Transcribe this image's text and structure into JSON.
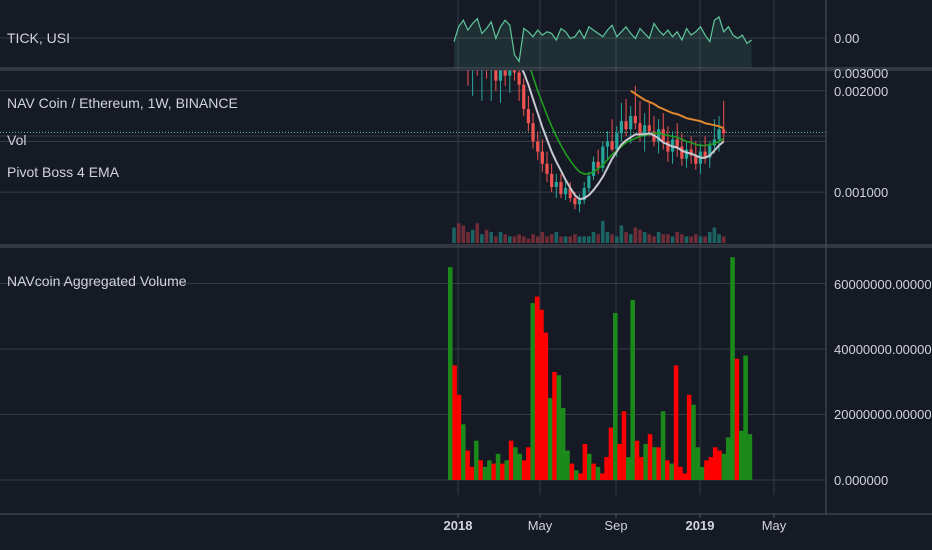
{
  "panes": {
    "tick": {
      "title": "TICK, USI",
      "price_label": "0.00"
    },
    "main": {
      "title": "NAV Coin / Ethereum, 1W, BINANCE",
      "indicators": [
        "Vol",
        "Pivot Boss 4 EMA"
      ]
    },
    "volume": {
      "title": "NAVcoin Aggregated Volume"
    }
  },
  "colors": {
    "background": "#161a25",
    "grid": "#363a45",
    "up": "#1b8a1b",
    "down": "#ff0000",
    "tick_line": "#5ec79a",
    "ema_white": "#c8c8d0",
    "ema_green": "#1f9e1f",
    "ema_orange": "#e08a2e",
    "last_price_line": "#4fd1a5"
  },
  "chart_data": [
    {
      "type": "line",
      "pane": "TICK, USI",
      "yticks": [
        "0.00"
      ],
      "x": [
        "2017-12-25",
        "2018-01-01",
        "2018-01-08",
        "2018-01-15",
        "2018-01-22",
        "2018-01-29",
        "2018-02-05",
        "2018-02-12",
        "2018-02-19",
        "2018-02-26",
        "2018-03-05",
        "2018-03-12",
        "2018-03-19",
        "2018-03-26",
        "2018-04-02",
        "2018-04-09",
        "2018-04-16",
        "2018-04-23",
        "2018-04-30",
        "2018-05-07",
        "2018-05-14",
        "2018-05-21",
        "2018-05-28",
        "2018-06-04",
        "2018-06-11",
        "2018-06-18",
        "2018-06-25",
        "2018-07-02",
        "2018-07-09",
        "2018-07-16",
        "2018-07-23",
        "2018-07-30",
        "2018-08-06",
        "2018-08-13",
        "2018-08-20",
        "2018-08-27",
        "2018-09-03",
        "2018-09-10",
        "2018-09-17",
        "2018-09-24",
        "2018-10-01",
        "2018-10-08",
        "2018-10-15",
        "2018-10-22",
        "2018-10-29",
        "2018-11-05",
        "2018-11-12",
        "2018-11-19",
        "2018-11-26",
        "2018-12-03",
        "2018-12-10",
        "2018-12-17",
        "2018-12-24",
        "2018-12-31",
        "2019-01-07",
        "2019-01-14",
        "2019-01-21",
        "2019-01-28",
        "2019-02-04",
        "2019-02-11",
        "2019-02-18",
        "2019-02-25",
        "2019-03-04",
        "2019-03-11",
        "2019-03-18"
      ],
      "values": [
        -0.4,
        0.5,
        0.9,
        0.3,
        0.7,
        1.0,
        0.1,
        0.4,
        0.8,
        -0.2,
        0.5,
        0.9,
        0.6,
        -1.2,
        -1.6,
        0.4,
        0.2,
        -0.1,
        0.3,
        0.0,
        0.2,
        0.1,
        -0.3,
        0.4,
        0.2,
        -0.2,
        -0.1,
        0.3,
        -0.2,
        0.5,
        0.3,
        0.1,
        -0.1,
        0.3,
        0.6,
        -0.1,
        0.2,
        0.5,
        0.1,
        -0.2,
        0.4,
        0.1,
        -0.2,
        0.7,
        0.3,
        0.0,
        0.3,
        -0.1,
        0.2,
        -0.3,
        0.4,
        0.0,
        0.2,
        0.5,
        0.0,
        -0.4,
        0.9,
        1.1,
        0.2,
        0.5,
        0.0,
        -0.2,
        0.0,
        -0.5,
        -0.3
      ],
      "ylim": [
        -2,
        1.4
      ]
    },
    {
      "type": "candlestick",
      "pane": "NAV Coin / Ethereum, 1W, BINANCE",
      "yticks": [
        "0.001000",
        "0.002000",
        "0.003000"
      ],
      "last_price": 0.00159,
      "x_start": "2017-12-25",
      "interval": "1W",
      "ylim": [
        0.00052,
        0.00318
      ],
      "ohlc": [
        [
          0.00275,
          0.00318,
          0.00265,
          0.0029
        ],
        [
          0.0029,
          0.00312,
          0.00268,
          0.00272
        ],
        [
          0.00272,
          0.003,
          0.0023,
          0.0024
        ],
        [
          0.0024,
          0.0027,
          0.00205,
          0.00222
        ],
        [
          0.00222,
          0.00265,
          0.00195,
          0.0025
        ],
        [
          0.0025,
          0.00275,
          0.00215,
          0.00222
        ],
        [
          0.00222,
          0.0024,
          0.0019,
          0.0023
        ],
        [
          0.0023,
          0.0026,
          0.00212,
          0.00222
        ],
        [
          0.00222,
          0.00242,
          0.0019,
          0.00232
        ],
        [
          0.00232,
          0.0025,
          0.002,
          0.0021
        ],
        [
          0.0021,
          0.0024,
          0.00188,
          0.00228
        ],
        [
          0.00228,
          0.00248,
          0.00205,
          0.00215
        ],
        [
          0.00215,
          0.00238,
          0.00198,
          0.00232
        ],
        [
          0.00232,
          0.00238,
          0.0021,
          0.00218
        ],
        [
          0.00218,
          0.00228,
          0.0019,
          0.00206
        ],
        [
          0.00206,
          0.00212,
          0.00175,
          0.00182
        ],
        [
          0.00182,
          0.00195,
          0.0016,
          0.00168
        ],
        [
          0.00168,
          0.00178,
          0.00143,
          0.0015
        ],
        [
          0.0015,
          0.0016,
          0.00132,
          0.0014
        ],
        [
          0.0014,
          0.00152,
          0.0012,
          0.00128
        ],
        [
          0.00128,
          0.0014,
          0.0011,
          0.00118
        ],
        [
          0.00118,
          0.00128,
          0.001,
          0.00105
        ],
        [
          0.00105,
          0.00118,
          0.00094,
          0.0011
        ],
        [
          0.0011,
          0.00118,
          0.00094,
          0.00098
        ],
        [
          0.00098,
          0.00112,
          0.00092,
          0.00104
        ],
        [
          0.00104,
          0.0011,
          0.0009,
          0.00094
        ],
        [
          0.00094,
          0.001,
          0.00083,
          0.00088
        ],
        [
          0.00088,
          0.00098,
          0.0008,
          0.00092
        ],
        [
          0.00092,
          0.0011,
          0.00088,
          0.00104
        ],
        [
          0.00104,
          0.0012,
          0.001,
          0.00116
        ],
        [
          0.00116,
          0.00135,
          0.00112,
          0.0013
        ],
        [
          0.0013,
          0.00142,
          0.00118,
          0.00124
        ],
        [
          0.00124,
          0.0015,
          0.0012,
          0.00145
        ],
        [
          0.00145,
          0.0016,
          0.00132,
          0.0015
        ],
        [
          0.0015,
          0.00172,
          0.0014,
          0.00142
        ],
        [
          0.00142,
          0.00165,
          0.00135,
          0.00158
        ],
        [
          0.00158,
          0.00188,
          0.0015,
          0.0017
        ],
        [
          0.0017,
          0.00192,
          0.00155,
          0.00162
        ],
        [
          0.00162,
          0.00185,
          0.00148,
          0.00175
        ],
        [
          0.00175,
          0.00205,
          0.00162,
          0.00168
        ],
        [
          0.00168,
          0.0019,
          0.0015,
          0.00155
        ],
        [
          0.00155,
          0.00178,
          0.0014,
          0.00166
        ],
        [
          0.00166,
          0.0019,
          0.00155,
          0.0016
        ],
        [
          0.0016,
          0.00175,
          0.00145,
          0.0015
        ],
        [
          0.0015,
          0.00172,
          0.00138,
          0.00162
        ],
        [
          0.00162,
          0.00178,
          0.00142,
          0.0015
        ],
        [
          0.0015,
          0.00165,
          0.0013,
          0.0014
        ],
        [
          0.0014,
          0.0016,
          0.00128,
          0.00152
        ],
        [
          0.00152,
          0.00168,
          0.00135,
          0.00145
        ],
        [
          0.00145,
          0.00158,
          0.00126,
          0.00133
        ],
        [
          0.00133,
          0.0015,
          0.00124,
          0.00142
        ],
        [
          0.00142,
          0.00155,
          0.00128,
          0.00136
        ],
        [
          0.00136,
          0.0015,
          0.00122,
          0.00128
        ],
        [
          0.00128,
          0.00148,
          0.00118,
          0.0014
        ],
        [
          0.0014,
          0.00155,
          0.00128,
          0.00134
        ],
        [
          0.00134,
          0.0015,
          0.00124,
          0.00146
        ],
        [
          0.00146,
          0.00172,
          0.00138,
          0.00152
        ],
        [
          0.00152,
          0.00175,
          0.0014,
          0.00162
        ],
        [
          0.00162,
          0.0019,
          0.0015,
          0.00158
        ]
      ],
      "ema_white": [
        null,
        null,
        null,
        null,
        null,
        null,
        0.00262,
        0.0025,
        0.00242,
        0.00236,
        0.00232,
        0.0023,
        0.00228,
        0.00229,
        0.00226,
        0.00218,
        0.00206,
        0.00192,
        0.00178,
        0.00164,
        0.00152,
        0.0014,
        0.0013,
        0.00121,
        0.00112,
        0.00104,
        0.00097,
        0.00093,
        0.00094,
        0.00097,
        0.00102,
        0.00108,
        0.00115,
        0.00124,
        0.00133,
        0.0014,
        0.00147,
        0.00151,
        0.00154,
        0.00157,
        0.00157,
        0.00157,
        0.00158,
        0.00156,
        0.00153,
        0.00149,
        0.00147,
        0.00145,
        0.00144,
        0.00141,
        0.00139,
        0.00138,
        0.00136,
        0.00134,
        0.00134,
        0.00136,
        0.00141,
        0.00146,
        0.0015
      ],
      "ema_green": [
        null,
        null,
        null,
        null,
        null,
        null,
        null,
        null,
        null,
        null,
        0.0031,
        0.00295,
        0.0028,
        0.00268,
        0.00255,
        0.00242,
        0.00228,
        0.00214,
        0.002,
        0.00188,
        0.00176,
        0.00165,
        0.00155,
        0.00146,
        0.00138,
        0.00131,
        0.00125,
        0.0012,
        0.00118,
        0.00118,
        0.0012,
        0.00123,
        0.00127,
        0.00132,
        0.00137,
        0.00141,
        0.00145,
        0.00149,
        0.00151,
        0.00153,
        0.00155,
        0.00156,
        0.00157,
        0.00158,
        0.00158,
        0.00157,
        0.00156,
        0.00155,
        0.00154,
        0.00152,
        0.0015,
        0.00149,
        0.00147,
        0.00146,
        0.00146,
        0.00147,
        0.00148,
        0.0015,
        0.00153
      ],
      "ema_orange": [
        null,
        null,
        null,
        null,
        null,
        null,
        null,
        null,
        null,
        null,
        null,
        null,
        null,
        null,
        null,
        null,
        null,
        null,
        null,
        null,
        null,
        null,
        null,
        null,
        null,
        null,
        null,
        null,
        null,
        null,
        null,
        null,
        null,
        null,
        null,
        null,
        null,
        null,
        0.002,
        0.00197,
        0.00194,
        0.00191,
        0.00189,
        0.00187,
        0.00184,
        0.00182,
        0.0018,
        0.00178,
        0.00177,
        0.00175,
        0.00173,
        0.00172,
        0.00171,
        0.0017,
        0.00168,
        0.00167,
        0.00166,
        0.00165,
        0.00163
      ],
      "vol": [
        0.7,
        0.9,
        0.8,
        0.5,
        0.6,
        0.9,
        0.4,
        0.6,
        0.5,
        0.3,
        0.5,
        0.4,
        0.3,
        0.3,
        0.4,
        0.3,
        0.2,
        0.4,
        0.3,
        0.5,
        0.3,
        0.4,
        0.5,
        0.3,
        0.3,
        0.3,
        0.4,
        0.3,
        0.3,
        0.3,
        0.5,
        0.4,
        1.0,
        0.5,
        0.4,
        0.3,
        0.8,
        0.5,
        0.4,
        0.7,
        0.6,
        0.5,
        0.4,
        0.3,
        0.5,
        0.4,
        0.4,
        0.3,
        0.5,
        0.4,
        0.3,
        0.3,
        0.4,
        0.3,
        0.3,
        0.5,
        0.7,
        0.4,
        0.3
      ]
    },
    {
      "type": "bar",
      "pane": "NAVcoin Aggregated Volume",
      "yticks": [
        "0.000000",
        "20000000.000000",
        "40000000.000000",
        "60000000.000000"
      ],
      "ylim": [
        -3000000,
        74000000
      ],
      "values": [
        65000000,
        35000000,
        26000000,
        17000000,
        9000000,
        4000000,
        12000000,
        6000000,
        4000000,
        6000000,
        5000000,
        8000000,
        5000000,
        6000000,
        12000000,
        10000000,
        8000000,
        6000000,
        10000000,
        54000000,
        56000000,
        52000000,
        45000000,
        25000000,
        33000000,
        32000000,
        22000000,
        9000000,
        5000000,
        3000000,
        2000000,
        11000000,
        8000000,
        5000000,
        4000000,
        2000000,
        7000000,
        16000000,
        51000000,
        11000000,
        21000000,
        7000000,
        55000000,
        12000000,
        7000000,
        11000000,
        14000000,
        10000000,
        10000000,
        21000000,
        6000000,
        5000000,
        35000000,
        4000000,
        2000000,
        26000000,
        23000000,
        10000000,
        4000000,
        6000000,
        7000000,
        10000000,
        9000000,
        8000000,
        13000000,
        68000000,
        37000000,
        15000000,
        38000000,
        14000000
      ],
      "up": [
        true,
        false,
        false,
        true,
        false,
        false,
        true,
        false,
        true,
        true,
        false,
        true,
        false,
        true,
        false,
        true,
        true,
        false,
        false,
        true,
        false,
        false,
        false,
        true,
        false,
        true,
        true,
        true,
        false,
        true,
        false,
        false,
        true,
        false,
        true,
        false,
        false,
        false,
        true,
        false,
        false,
        true,
        true,
        false,
        false,
        true,
        false,
        true,
        false,
        true,
        false,
        true,
        false,
        false,
        false,
        false,
        true,
        true,
        true,
        false,
        false,
        false,
        false,
        true,
        true,
        true,
        false,
        true,
        true,
        true
      ]
    }
  ],
  "time_axis": [
    "2018",
    "May",
    "Sep",
    "2019",
    "May"
  ]
}
